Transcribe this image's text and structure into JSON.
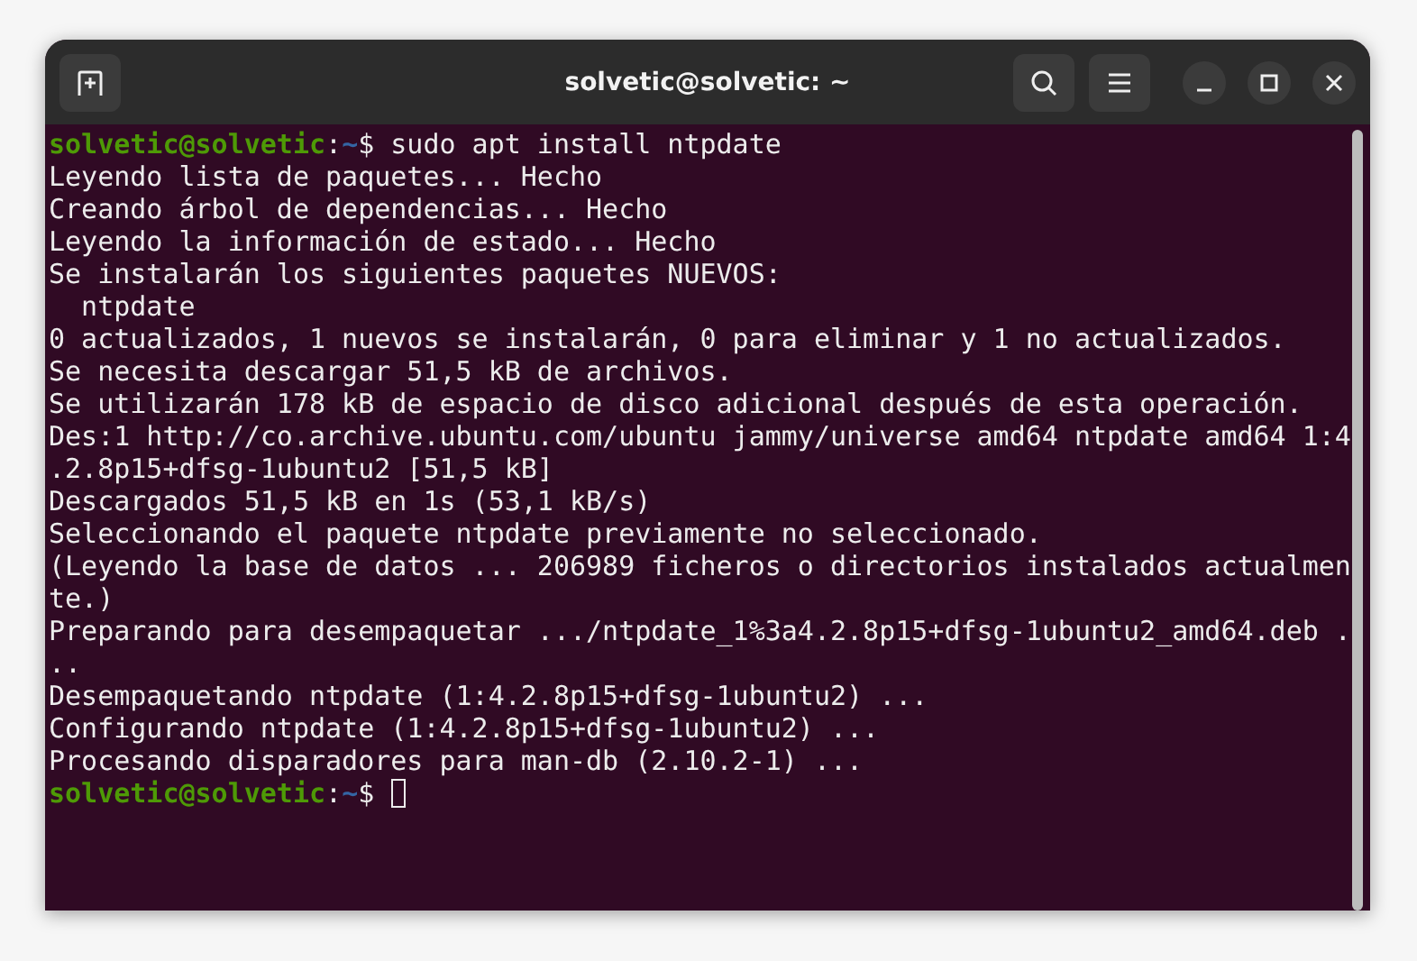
{
  "window": {
    "title": "solvetic@solvetic: ~"
  },
  "terminal": {
    "lines": [
      {
        "kind": "prompt",
        "user": "solvetic@solvetic",
        "separator": ":",
        "path": "~",
        "symbol": "$",
        "command": " sudo apt install ntpdate",
        "cursor": false
      },
      {
        "kind": "output",
        "text": "Leyendo lista de paquetes... Hecho"
      },
      {
        "kind": "output",
        "text": "Creando árbol de dependencias... Hecho"
      },
      {
        "kind": "output",
        "text": "Leyendo la información de estado... Hecho"
      },
      {
        "kind": "output",
        "text": "Se instalarán los siguientes paquetes NUEVOS:"
      },
      {
        "kind": "output",
        "text": "  ntpdate"
      },
      {
        "kind": "output",
        "text": "0 actualizados, 1 nuevos se instalarán, 0 para eliminar y 1 no actualizados."
      },
      {
        "kind": "output",
        "text": "Se necesita descargar 51,5 kB de archivos."
      },
      {
        "kind": "output",
        "text": "Se utilizarán 178 kB de espacio de disco adicional después de esta operación."
      },
      {
        "kind": "output",
        "text": "Des:1 http://co.archive.ubuntu.com/ubuntu jammy/universe amd64 ntpdate amd64 1:4"
      },
      {
        "kind": "output",
        "text": ".2.8p15+dfsg-1ubuntu2 [51,5 kB]"
      },
      {
        "kind": "output",
        "text": "Descargados 51,5 kB en 1s (53,1 kB/s)"
      },
      {
        "kind": "output",
        "text": "Seleccionando el paquete ntpdate previamente no seleccionado."
      },
      {
        "kind": "output",
        "text": "(Leyendo la base de datos ... 206989 ficheros o directorios instalados actualmen"
      },
      {
        "kind": "output",
        "text": "te.)"
      },
      {
        "kind": "output",
        "text": "Preparando para desempaquetar .../ntpdate_1%3a4.2.8p15+dfsg-1ubuntu2_amd64.deb ."
      },
      {
        "kind": "output",
        "text": ".."
      },
      {
        "kind": "output",
        "text": "Desempaquetando ntpdate (1:4.2.8p15+dfsg-1ubuntu2) ..."
      },
      {
        "kind": "output",
        "text": "Configurando ntpdate (1:4.2.8p15+dfsg-1ubuntu2) ..."
      },
      {
        "kind": "output",
        "text": "Procesando disparadores para man-db (2.10.2-1) ..."
      },
      {
        "kind": "prompt",
        "user": "solvetic@solvetic",
        "separator": ":",
        "path": "~",
        "symbol": "$",
        "cursor": true
      }
    ]
  }
}
